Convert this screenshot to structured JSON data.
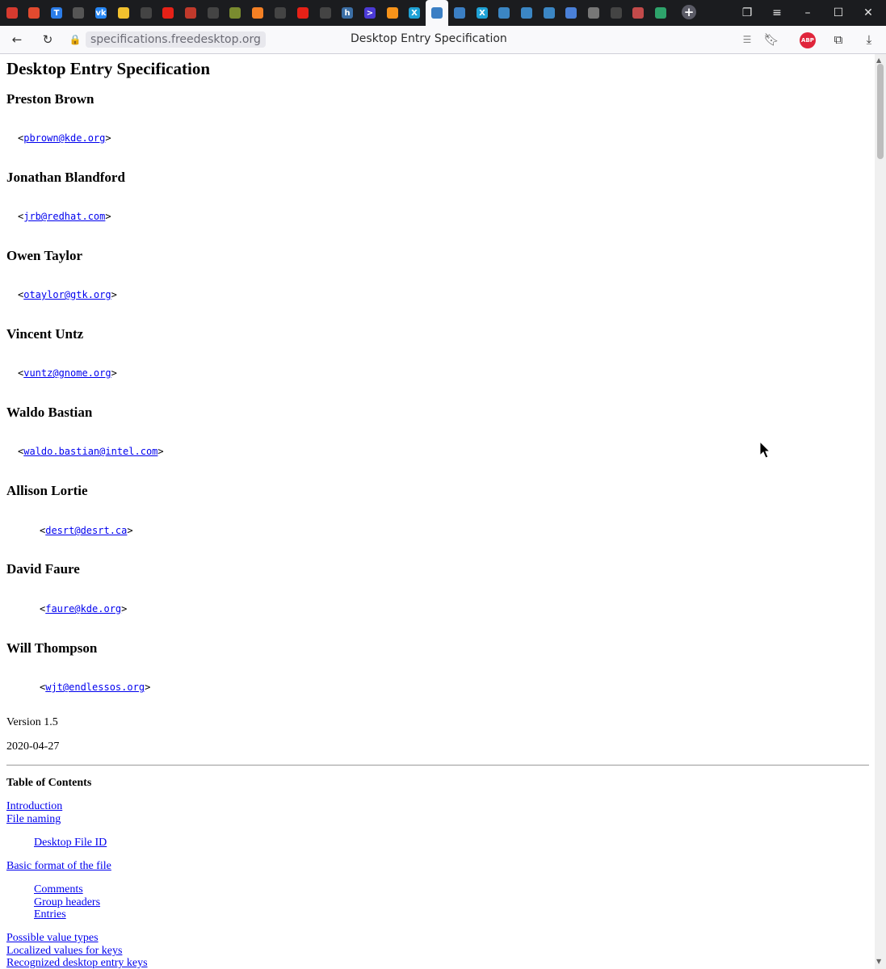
{
  "browser": {
    "url": "specifications.freedesktop.org",
    "title": "Desktop Entry Specification",
    "abp_label": "ABP",
    "new_tab_icon": "plus-icon",
    "window_buttons": [
      "minimize-icon",
      "maximize-icon",
      "close-icon"
    ]
  },
  "tabs": [
    {
      "icon": "app-red-icon",
      "color": "#d63a2f"
    },
    {
      "icon": "copyright-icon",
      "color": "#e24a2f"
    },
    {
      "icon": "t-icon",
      "color": "#2b7de9",
      "glyph": "T"
    },
    {
      "icon": "speaker-icon",
      "color": "#555555"
    },
    {
      "icon": "vk-icon",
      "color": "#2787f5",
      "glyph": "vk"
    },
    {
      "icon": "ghost-icon",
      "color": "#f2c12e"
    },
    {
      "icon": "github-icon",
      "color": "#444444"
    },
    {
      "icon": "youtube-icon",
      "color": "#e62117"
    },
    {
      "icon": "list-icon",
      "color": "#c0392b"
    },
    {
      "icon": "share-icon",
      "color": "#444444"
    },
    {
      "icon": "globe-icon",
      "color": "#7a8b2f"
    },
    {
      "icon": "stack-icon",
      "color": "#f48024"
    },
    {
      "icon": "github-icon",
      "color": "#444444"
    },
    {
      "icon": "youtube-icon",
      "color": "#e62117"
    },
    {
      "icon": "github-icon",
      "color": "#444444"
    },
    {
      "icon": "h-icon",
      "color": "#3b6ea5",
      "glyph": "h"
    },
    {
      "icon": "arrow-icon",
      "color": "#4b3ad6",
      "glyph": ">"
    },
    {
      "icon": "bitcoin-icon",
      "color": "#f7931a"
    },
    {
      "icon": "x-icon",
      "color": "#1fa2d6",
      "glyph": "X"
    },
    {
      "icon": "freedesktop-icon",
      "color": "#3b7fc4",
      "active": true
    },
    {
      "icon": "freedesktop-icon",
      "color": "#3b7fc4"
    },
    {
      "icon": "x-icon",
      "color": "#1fa2d6",
      "glyph": "X"
    },
    {
      "icon": "gear-icon",
      "color": "#3b86c4"
    },
    {
      "icon": "gear-icon",
      "color": "#3b86c4"
    },
    {
      "icon": "gear-icon",
      "color": "#3b86c4"
    },
    {
      "icon": "translate-icon",
      "color": "#4a80d8"
    },
    {
      "icon": "gear-icon",
      "color": "#777777"
    },
    {
      "icon": "github-icon",
      "color": "#444444"
    },
    {
      "icon": "image-icon",
      "color": "#c24a4a"
    },
    {
      "icon": "dice-icon",
      "color": "#2ea36b"
    }
  ],
  "doc": {
    "title": "Desktop Entry Specification",
    "authors": [
      {
        "name": "Preston Brown",
        "email": "pbrown@kde.org"
      },
      {
        "name": "Jonathan Blandford",
        "email": "jrb@redhat.com"
      },
      {
        "name": "Owen Taylor",
        "email": "otaylor@gtk.org"
      },
      {
        "name": "Vincent Untz",
        "email": "vuntz@gnome.org"
      },
      {
        "name": "Waldo Bastian",
        "email": "waldo.bastian@intel.com"
      },
      {
        "name": "Allison Lortie",
        "email": "desrt@desrt.ca"
      },
      {
        "name": "David Faure",
        "email": "faure@kde.org"
      },
      {
        "name": "Will Thompson",
        "email": "wjt@endlessos.org"
      }
    ],
    "version": "Version 1.5",
    "date": "2020-04-27",
    "toc_title": "Table of Contents",
    "toc": [
      {
        "label": "Introduction",
        "level": 0
      },
      {
        "label": "File naming",
        "level": 0
      },
      {
        "label": "Desktop File ID",
        "level": 1
      },
      {
        "label": "Basic format of the file",
        "level": 0
      },
      {
        "label": "Comments",
        "level": 1
      },
      {
        "label": "Group headers",
        "level": 1
      },
      {
        "label": "Entries",
        "level": 1
      },
      {
        "label": "Possible value types",
        "level": 0
      },
      {
        "label": "Localized values for keys",
        "level": 0
      },
      {
        "label": "Recognized desktop entry keys",
        "level": 0
      }
    ]
  }
}
